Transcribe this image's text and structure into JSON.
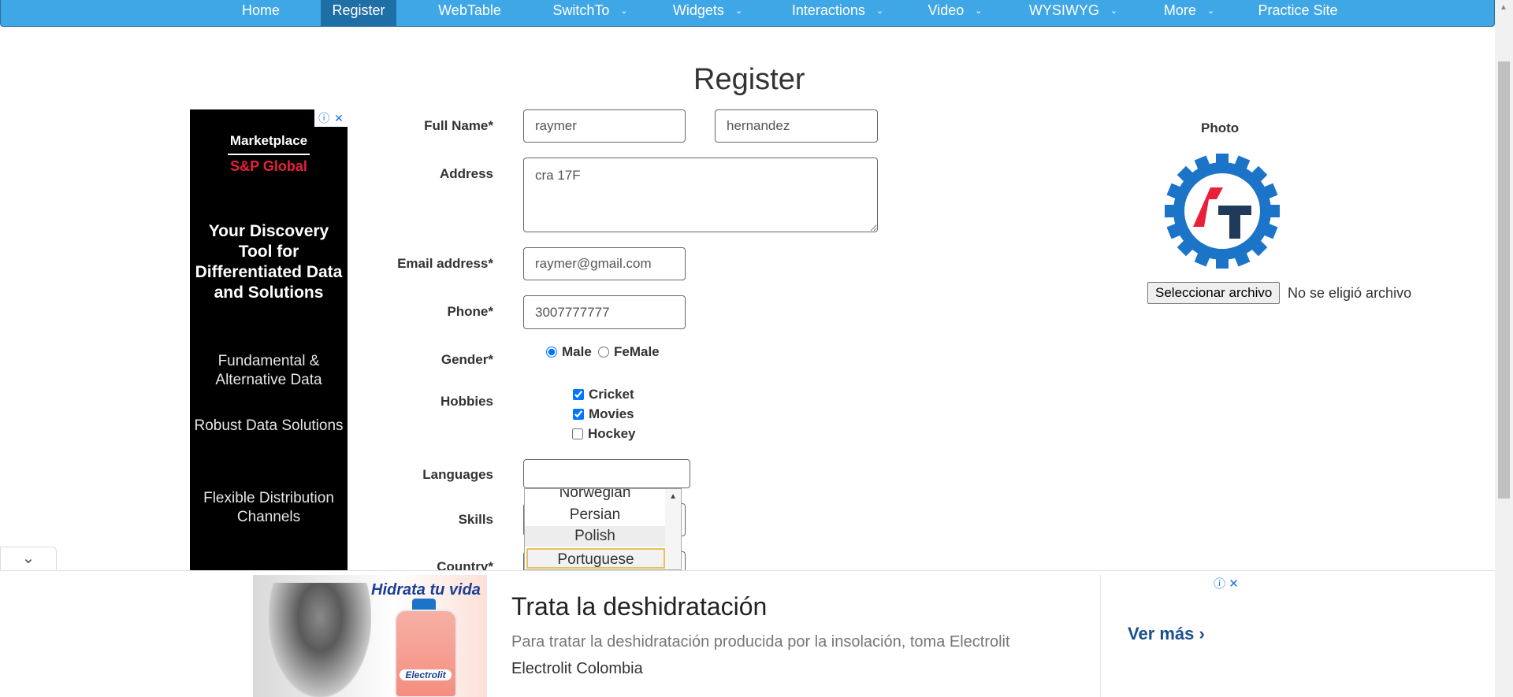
{
  "nav": {
    "items": [
      {
        "label": "Home",
        "dropdown": false,
        "active": false
      },
      {
        "label": "Register",
        "dropdown": false,
        "active": true
      },
      {
        "label": "WebTable",
        "dropdown": false,
        "active": false
      },
      {
        "label": "SwitchTo",
        "dropdown": true,
        "active": false
      },
      {
        "label": "Widgets",
        "dropdown": true,
        "active": false
      },
      {
        "label": "Interactions",
        "dropdown": true,
        "active": false
      },
      {
        "label": "Video",
        "dropdown": true,
        "active": false
      },
      {
        "label": "WYSIWYG",
        "dropdown": true,
        "active": false
      },
      {
        "label": "More",
        "dropdown": true,
        "active": false
      },
      {
        "label": "Practice Site",
        "dropdown": false,
        "active": false
      }
    ],
    "caret": "⌄"
  },
  "page": {
    "title": "Register"
  },
  "left_ad": {
    "brand_top": "Marketplace",
    "brand_bottom": "S&P Global",
    "headline": "Your Discovery Tool for Differentiated Data and Solutions",
    "line1": "Fundamental & Alternative Data",
    "line2": "Robust Data Solutions",
    "line3": "Flexible Distribution Channels",
    "info_icon": "ⓘ",
    "close_icon": "✕"
  },
  "form": {
    "full_name_label": "Full Name*",
    "first_name": "raymer",
    "last_name": "hernandez",
    "address_label": "Address",
    "address": "cra 17F",
    "email_label": "Email address*",
    "email": "raymer@gmail.com",
    "phone_label": "Phone*",
    "phone": "3007777777",
    "gender_label": "Gender*",
    "gender_male": "Male",
    "gender_female": "FeMale",
    "hobbies_label": "Hobbies",
    "hobby_cricket": "Cricket",
    "hobby_movies": "Movies",
    "hobby_hockey": "Hockey",
    "languages_label": "Languages",
    "languages_value": "",
    "skills_label": "Skills",
    "country_label": "Country*"
  },
  "languages_dropdown": {
    "items": [
      "Norwegian",
      "Persian",
      "Polish",
      "Portuguese"
    ],
    "hovered": "Polish",
    "selected": "Portuguese"
  },
  "photo": {
    "label": "Photo",
    "file_button": "Seleccionar archivo",
    "file_status": "No se eligió archivo"
  },
  "bottom_ad": {
    "image_text": "Hidrata tu vida",
    "bottle_brand": "Electrolit",
    "title": "Trata la deshidratación",
    "description": "Para tratar la deshidratación producida por la insolación, toma Electrolit",
    "brand": "Electrolit Colombia",
    "cta": "Ver más",
    "cta_icon": "›",
    "info_icon": "ⓘ",
    "close_icon": "✕",
    "collapse_icon": "⌄"
  },
  "colors": {
    "nav_bg": "#3fa7e6",
    "nav_active": "#1f6fa7",
    "logo_blue": "#1c74c9",
    "logo_red": "#e8203a",
    "logo_navy": "#1f3a5a"
  }
}
